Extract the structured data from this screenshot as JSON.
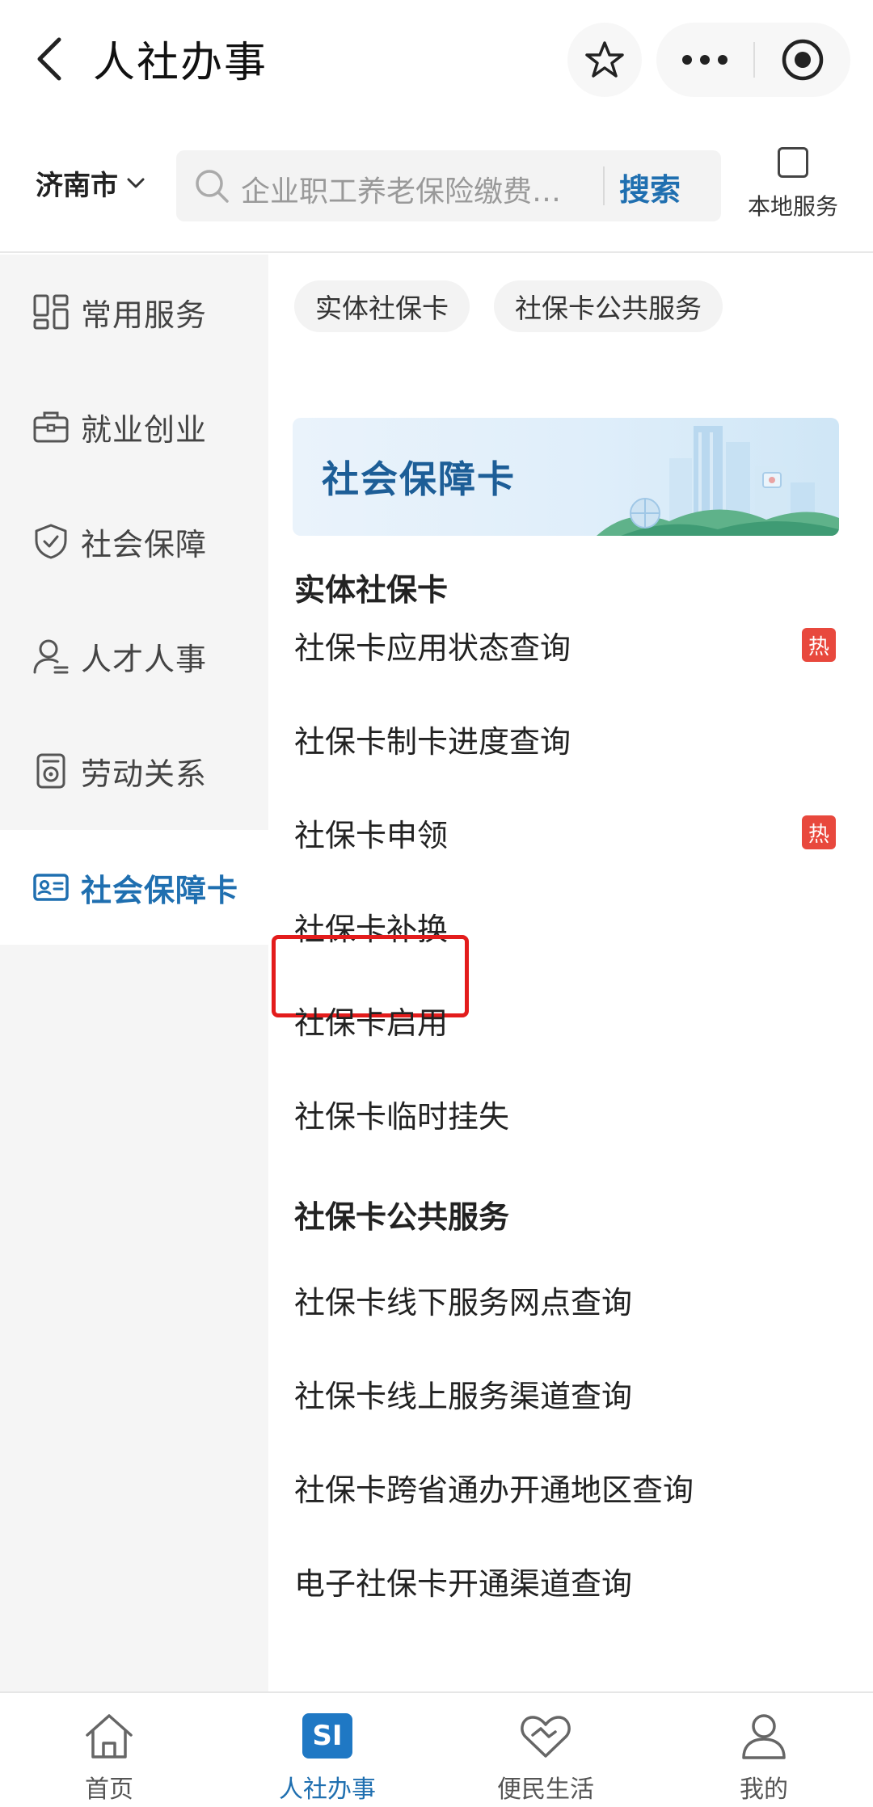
{
  "header": {
    "title": "人社办事"
  },
  "search": {
    "city": "济南市",
    "placeholder": "企业职工养老保险缴费…",
    "button": "搜索",
    "local_service": "本地服务"
  },
  "sidebar": {
    "items": [
      {
        "label": "常用服务",
        "icon": "grid-icon"
      },
      {
        "label": "就业创业",
        "icon": "briefcase-icon"
      },
      {
        "label": "社会保障",
        "icon": "shield-icon"
      },
      {
        "label": "人才人事",
        "icon": "person-icon"
      },
      {
        "label": "劳动关系",
        "icon": "document-icon"
      },
      {
        "label": "社会保障卡",
        "icon": "id-card-icon",
        "active": true
      }
    ]
  },
  "main": {
    "chips": [
      "实体社保卡",
      "社保卡公共服务"
    ],
    "banner_title": "社会保障卡",
    "sections": [
      {
        "title": "实体社保卡",
        "items": [
          {
            "label": "社保卡应用状态查询",
            "badge": "热"
          },
          {
            "label": "社保卡制卡进度查询"
          },
          {
            "label": "社保卡申领",
            "badge": "热"
          },
          {
            "label": "社保卡补换",
            "highlighted": true
          },
          {
            "label": "社保卡启用"
          },
          {
            "label": "社保卡临时挂失"
          }
        ]
      },
      {
        "title": "社保卡公共服务",
        "items": [
          {
            "label": "社保卡线下服务网点查询"
          },
          {
            "label": "社保卡线上服务渠道查询"
          },
          {
            "label": "社保卡跨省通办开通地区查询"
          },
          {
            "label": "电子社保卡开通渠道查询"
          }
        ]
      }
    ]
  },
  "tabbar": {
    "tabs": [
      {
        "label": "首页",
        "icon": "home-icon"
      },
      {
        "label": "人社办事",
        "icon": "si-icon",
        "active": true,
        "badge_text": "SI"
      },
      {
        "label": "便民生活",
        "icon": "handshake-heart-icon"
      },
      {
        "label": "我的",
        "icon": "user-icon"
      }
    ]
  },
  "colors": {
    "accent": "#1f6fb0",
    "hot_badge": "#e8483d",
    "highlight_border": "#e31c1c"
  }
}
